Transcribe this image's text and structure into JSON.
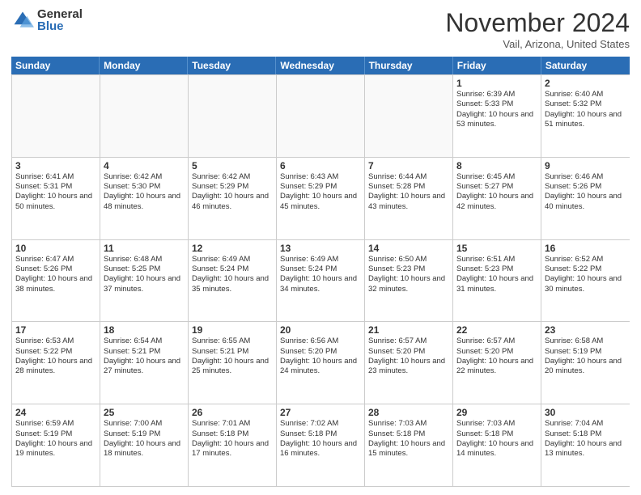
{
  "logo": {
    "general": "General",
    "blue": "Blue"
  },
  "title": "November 2024",
  "location": "Vail, Arizona, United States",
  "weekdays": [
    "Sunday",
    "Monday",
    "Tuesday",
    "Wednesday",
    "Thursday",
    "Friday",
    "Saturday"
  ],
  "weeks": [
    [
      {
        "day": "",
        "info": ""
      },
      {
        "day": "",
        "info": ""
      },
      {
        "day": "",
        "info": ""
      },
      {
        "day": "",
        "info": ""
      },
      {
        "day": "",
        "info": ""
      },
      {
        "day": "1",
        "info": "Sunrise: 6:39 AM\nSunset: 5:33 PM\nDaylight: 10 hours and 53 minutes."
      },
      {
        "day": "2",
        "info": "Sunrise: 6:40 AM\nSunset: 5:32 PM\nDaylight: 10 hours and 51 minutes."
      }
    ],
    [
      {
        "day": "3",
        "info": "Sunrise: 6:41 AM\nSunset: 5:31 PM\nDaylight: 10 hours and 50 minutes."
      },
      {
        "day": "4",
        "info": "Sunrise: 6:42 AM\nSunset: 5:30 PM\nDaylight: 10 hours and 48 minutes."
      },
      {
        "day": "5",
        "info": "Sunrise: 6:42 AM\nSunset: 5:29 PM\nDaylight: 10 hours and 46 minutes."
      },
      {
        "day": "6",
        "info": "Sunrise: 6:43 AM\nSunset: 5:29 PM\nDaylight: 10 hours and 45 minutes."
      },
      {
        "day": "7",
        "info": "Sunrise: 6:44 AM\nSunset: 5:28 PM\nDaylight: 10 hours and 43 minutes."
      },
      {
        "day": "8",
        "info": "Sunrise: 6:45 AM\nSunset: 5:27 PM\nDaylight: 10 hours and 42 minutes."
      },
      {
        "day": "9",
        "info": "Sunrise: 6:46 AM\nSunset: 5:26 PM\nDaylight: 10 hours and 40 minutes."
      }
    ],
    [
      {
        "day": "10",
        "info": "Sunrise: 6:47 AM\nSunset: 5:26 PM\nDaylight: 10 hours and 38 minutes."
      },
      {
        "day": "11",
        "info": "Sunrise: 6:48 AM\nSunset: 5:25 PM\nDaylight: 10 hours and 37 minutes."
      },
      {
        "day": "12",
        "info": "Sunrise: 6:49 AM\nSunset: 5:24 PM\nDaylight: 10 hours and 35 minutes."
      },
      {
        "day": "13",
        "info": "Sunrise: 6:49 AM\nSunset: 5:24 PM\nDaylight: 10 hours and 34 minutes."
      },
      {
        "day": "14",
        "info": "Sunrise: 6:50 AM\nSunset: 5:23 PM\nDaylight: 10 hours and 32 minutes."
      },
      {
        "day": "15",
        "info": "Sunrise: 6:51 AM\nSunset: 5:23 PM\nDaylight: 10 hours and 31 minutes."
      },
      {
        "day": "16",
        "info": "Sunrise: 6:52 AM\nSunset: 5:22 PM\nDaylight: 10 hours and 30 minutes."
      }
    ],
    [
      {
        "day": "17",
        "info": "Sunrise: 6:53 AM\nSunset: 5:22 PM\nDaylight: 10 hours and 28 minutes."
      },
      {
        "day": "18",
        "info": "Sunrise: 6:54 AM\nSunset: 5:21 PM\nDaylight: 10 hours and 27 minutes."
      },
      {
        "day": "19",
        "info": "Sunrise: 6:55 AM\nSunset: 5:21 PM\nDaylight: 10 hours and 25 minutes."
      },
      {
        "day": "20",
        "info": "Sunrise: 6:56 AM\nSunset: 5:20 PM\nDaylight: 10 hours and 24 minutes."
      },
      {
        "day": "21",
        "info": "Sunrise: 6:57 AM\nSunset: 5:20 PM\nDaylight: 10 hours and 23 minutes."
      },
      {
        "day": "22",
        "info": "Sunrise: 6:57 AM\nSunset: 5:20 PM\nDaylight: 10 hours and 22 minutes."
      },
      {
        "day": "23",
        "info": "Sunrise: 6:58 AM\nSunset: 5:19 PM\nDaylight: 10 hours and 20 minutes."
      }
    ],
    [
      {
        "day": "24",
        "info": "Sunrise: 6:59 AM\nSunset: 5:19 PM\nDaylight: 10 hours and 19 minutes."
      },
      {
        "day": "25",
        "info": "Sunrise: 7:00 AM\nSunset: 5:19 PM\nDaylight: 10 hours and 18 minutes."
      },
      {
        "day": "26",
        "info": "Sunrise: 7:01 AM\nSunset: 5:18 PM\nDaylight: 10 hours and 17 minutes."
      },
      {
        "day": "27",
        "info": "Sunrise: 7:02 AM\nSunset: 5:18 PM\nDaylight: 10 hours and 16 minutes."
      },
      {
        "day": "28",
        "info": "Sunrise: 7:03 AM\nSunset: 5:18 PM\nDaylight: 10 hours and 15 minutes."
      },
      {
        "day": "29",
        "info": "Sunrise: 7:03 AM\nSunset: 5:18 PM\nDaylight: 10 hours and 14 minutes."
      },
      {
        "day": "30",
        "info": "Sunrise: 7:04 AM\nSunset: 5:18 PM\nDaylight: 10 hours and 13 minutes."
      }
    ]
  ]
}
